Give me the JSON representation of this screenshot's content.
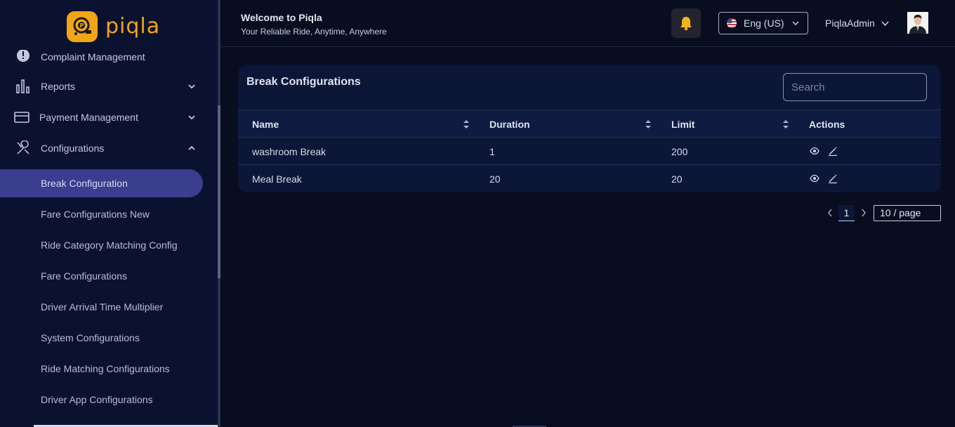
{
  "brand": {
    "name": "piqla",
    "color": "#f2a516"
  },
  "header": {
    "title": "Welcome to Piqla",
    "subtitle": "Your Reliable Ride, Anytime, Anywhere",
    "language": "Eng (US)",
    "user_name": "PiqlaAdmin"
  },
  "sidebar": {
    "items": [
      {
        "label": "Complaint Management",
        "icon": "alert-icon"
      },
      {
        "label": "Reports",
        "icon": "bar-chart-icon"
      },
      {
        "label": "Payment Management",
        "icon": "credit-card-icon"
      },
      {
        "label": "Configurations",
        "icon": "tools-icon"
      }
    ],
    "sub_items": [
      {
        "label": "Break Configuration",
        "active": true
      },
      {
        "label": "Fare Configurations New"
      },
      {
        "label": "Ride Category Matching Config"
      },
      {
        "label": "Fare Configurations"
      },
      {
        "label": "Driver Arrival Time Multiplier"
      },
      {
        "label": "System Configurations"
      },
      {
        "label": "Ride Matching Configurations"
      },
      {
        "label": "Driver App Configurations"
      }
    ],
    "active_color": "#3b3d8e"
  },
  "card": {
    "title": "Break Configurations",
    "search_placeholder": "Search",
    "columns": [
      "Name",
      "Duration",
      "Limit",
      "Actions"
    ],
    "rows": [
      {
        "name": "washroom Break",
        "duration": "1",
        "limit": "200"
      },
      {
        "name": "Meal Break",
        "duration": "20",
        "limit": "20"
      }
    ]
  },
  "pagination": {
    "current_page": "1",
    "page_size": "10 / page"
  }
}
